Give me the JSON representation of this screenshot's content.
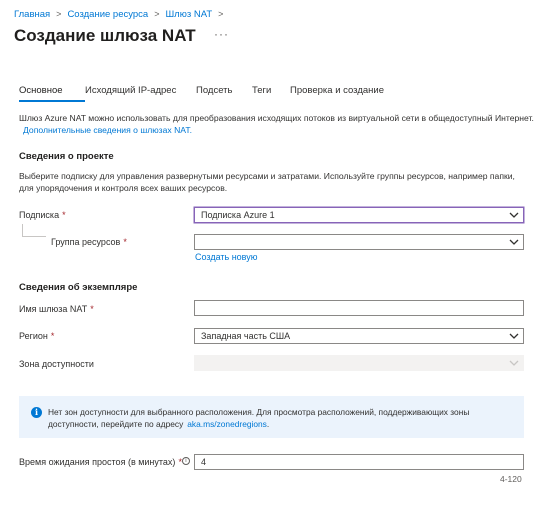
{
  "breadcrumb": {
    "items": [
      "Главная",
      "Создание ресурса",
      "Шлюз NAT"
    ],
    "separator": ">"
  },
  "page": {
    "title": "Создание шлюза NAT",
    "more": "···"
  },
  "tabs": [
    "Основное",
    "Исходящий IP-адрес",
    "Подсеть",
    "Теги",
    "Проверка и создание"
  ],
  "intro": {
    "text": "Шлюз Azure NAT можно использовать для преобразования исходящих потоков из виртуальной сети в общедоступный Интернет.",
    "link": "Дополнительные сведения о шлюзах NAT."
  },
  "project": {
    "title": "Сведения о проекте",
    "description": "Выберите подписку для управления развернутыми ресурсами и затратами. Используйте группы ресурсов, например папки, для упорядочения и контроля всех ваших ресурсов.",
    "subscription_label": "Подписка",
    "subscription_value": "Подписка Azure 1",
    "resource_group_label": "Группа ресурсов",
    "resource_group_value": "",
    "create_new": "Создать новую"
  },
  "instance": {
    "title": "Сведения об экземпляре",
    "name_label": "Имя шлюза NAT",
    "name_value": "",
    "region_label": "Регион",
    "region_value": "Западная часть США",
    "zone_label": "Зона доступности",
    "zone_value": ""
  },
  "info": {
    "icon": "info-icon",
    "text": "Нет зон доступности для выбранного расположения. Для просмотра расположений, поддерживающих зоны доступности, перейдите по адресу",
    "link": "aka.ms/zonedregions",
    "trailing": "."
  },
  "timeout": {
    "label": "Время ожидания простоя (в минутах)",
    "value": "4",
    "range": "4-120"
  },
  "required_marker": "*",
  "colors": {
    "accent": "#0078d4",
    "required": "#a4262c",
    "focus_border": "#8764b8",
    "info_background": "#ebf3fc"
  }
}
